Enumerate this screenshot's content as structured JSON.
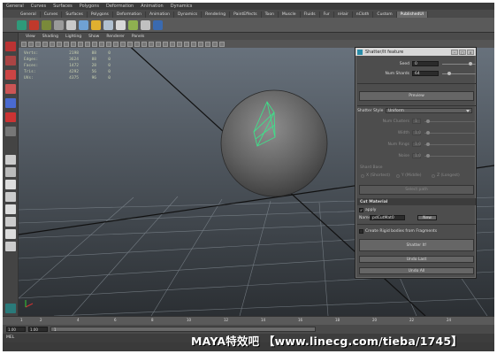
{
  "menu": [
    "General",
    "Curves",
    "Surfaces",
    "Polygons",
    "Deformation",
    "Animation",
    "Dynamics",
    "Rendering",
    "PaintEffects",
    "Toon",
    "Muscle",
    "Fluids",
    "Fur",
    "nHair",
    "nCloth",
    "Custom",
    "Pulldown/Shelf"
  ],
  "shelf_tabs": [
    "General",
    "Curves",
    "Surfaces",
    "Polygons",
    "Deformation",
    "Animation",
    "Dynamics",
    "Rendering",
    "PaintEffects",
    "Toon",
    "Muscle",
    "Fluids",
    "Fur",
    "nHair",
    "nCloth",
    "Custom",
    "PublishedUI"
  ],
  "shelf_active": "PublishedUI",
  "viewport": {
    "menu": [
      "View",
      "Shading",
      "Lighting",
      "Show",
      "Renderer",
      "Panels"
    ],
    "hud": [
      {
        "label": "Verts:",
        "v1": "2198",
        "v2": "88",
        "v3": "0"
      },
      {
        "label": "Edges:",
        "v1": "3624",
        "v2": "88",
        "v3": "0"
      },
      {
        "label": "Faces:",
        "v1": "1472",
        "v2": "28",
        "v3": "0"
      },
      {
        "label": "Tris:",
        "v1": "4292",
        "v2": "56",
        "v3": "0"
      },
      {
        "label": "UVs:",
        "v1": "4375",
        "v2": "96",
        "v3": "0"
      }
    ]
  },
  "dialog": {
    "title": "Shatter/It feature",
    "seed_label": "Seed",
    "seed_value": "0",
    "num_shards_label": "Num Shards",
    "num_shards_value": "64",
    "preview_label": "Preview",
    "shatter_style_label": "Shatter Style",
    "shatter_style_value": "Uniform",
    "num_clusters_label": "Num Clusters",
    "width_label": "Width",
    "num_rings_label": "Num Rings",
    "noise_label": "Noise",
    "width_value": "1.0",
    "rings_value": "1.0",
    "noise_value": "1.0",
    "clusters_value": "1",
    "shards_section": "Shard Base",
    "radio_options": [
      "X (Shortest)",
      "Y (Middle)",
      "Z (Longest)"
    ],
    "select_path_label": "Select path",
    "cut_material_section": "Cut Material",
    "apply_label": "apply",
    "apply_checked": "✓",
    "name_label": "Name",
    "name_value": "pdCutMat0",
    "new_button": "New",
    "rigid_label": "Create Rigid bodies from Fragments",
    "shatter_button": "Shatter It!",
    "undo_last": "Undo Last",
    "undo_all": "Undo All"
  },
  "timeline": {
    "ticks": [
      "1",
      "2",
      "4",
      "6",
      "8",
      "10",
      "12",
      "14",
      "16",
      "18",
      "20",
      "22",
      "24"
    ],
    "start": "1.00",
    "end": "1.00",
    "range_start": "1"
  },
  "cmdline": {
    "label": "MEL"
  },
  "watermark": "MAYA特效吧 【www.linecg.com/tieba/1745】"
}
